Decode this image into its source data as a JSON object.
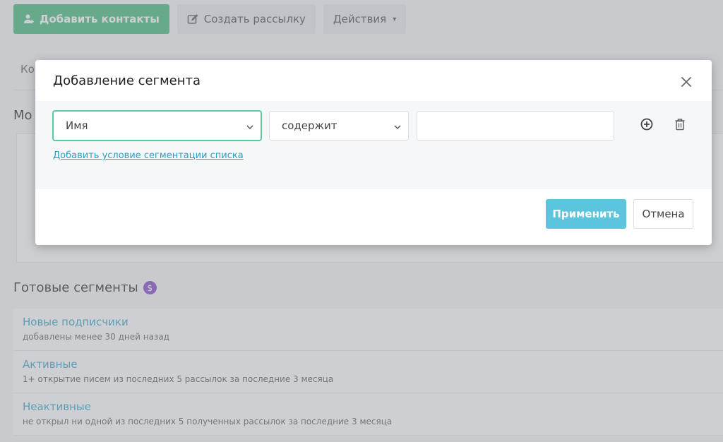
{
  "toolbar": {
    "add_contacts": "Добавить контакты",
    "create_mailing": "Создать рассылку",
    "actions": "Действия",
    "actions_caret": "▾"
  },
  "tabs": {
    "first_label_partial": "Ко"
  },
  "my_segments": {
    "title_partial": "Мо"
  },
  "ready_segments": {
    "title": "Готовые сегменты",
    "badge": "$",
    "items": [
      {
        "name": "Новые подписчики",
        "desc": "добавлены менее 30 дней назад"
      },
      {
        "name": "Активные",
        "desc": "1+ открытие писем из последних 5 рассылок за последние 3 месяца"
      },
      {
        "name": "Неактивные",
        "desc": "не открыл ни одной из последних 5 полученных рассылок за последние 3 месяца"
      }
    ]
  },
  "modal": {
    "title": "Добавление сегмента",
    "field_select": "Имя",
    "operator_select": "содержит",
    "value_input": "",
    "add_condition_link": "Добавить условие сегментации списка",
    "apply": "Применить",
    "cancel": "Отмена"
  },
  "colors": {
    "green_button": "#3cb878",
    "link": "#2b9fc2",
    "apply_button": "#5bc5de",
    "badge_purple": "#7d3fc6",
    "focus_border": "#5dc9a0"
  },
  "icons": {
    "add_contacts": "user-plus-icon",
    "create_mailing": "pencil-square-icon",
    "close": "close-icon",
    "add_row": "plus-circle-icon",
    "delete_row": "trash-icon",
    "select_arrow": "chevron-down-icon"
  }
}
